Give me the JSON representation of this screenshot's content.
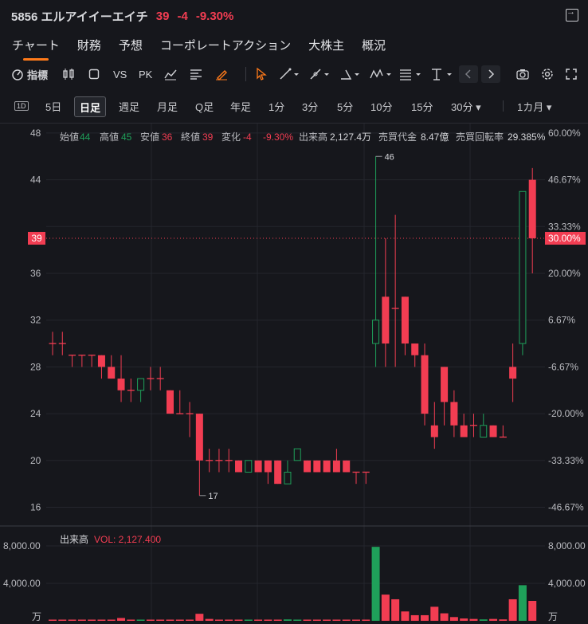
{
  "header": {
    "code_name": "5856 エルアイイーエイチ",
    "price": "39",
    "change": "-4",
    "change_pct": "-9.30%"
  },
  "tabs": [
    "チャート",
    "財務",
    "予想",
    "コーポレートアクション",
    "大株主",
    "概況"
  ],
  "toolbar": {
    "indicator_label": "指標",
    "vs_label": "VS",
    "pk_label": "PK"
  },
  "timeframes": [
    "1D",
    "5日",
    "日足",
    "週足",
    "月足",
    "Q足",
    "年足",
    "1分",
    "3分",
    "5分",
    "10分",
    "15分",
    "30分 ▾",
    "1カ月 ▾"
  ],
  "selected_timeframe": "日足",
  "ohlc_bar": {
    "open_label": "始値",
    "open": "44",
    "high_label": "高値",
    "high": "45",
    "low_label": "安値",
    "low": "36",
    "close_label": "終値",
    "close": "39",
    "chg_label": "変化",
    "chg": "-4",
    "chg_pct": "-9.30%",
    "vol_label": "出来高",
    "vol": "2,127.4万",
    "amount_label": "売買代金",
    "amount": "8.47億",
    "turnover_label": "売買回転率",
    "turnover": "29.385%"
  },
  "volume_legend": {
    "label": "出来高",
    "vol_text": "VOL: 2,127.400"
  },
  "colors": {
    "up": "#1fa05a",
    "down": "#f23d52",
    "bg": "#16171c",
    "grid": "#24262d",
    "text": "#b9babf",
    "accent": "#ff7a1a"
  },
  "chart_data": {
    "type": "candlestick",
    "price_axis": {
      "ticks": [
        16,
        20,
        24,
        28,
        32,
        36,
        40,
        44,
        48
      ],
      "range": [
        15,
        48
      ]
    },
    "percent_axis": {
      "ticks": [
        "60.00%",
        "46.67%",
        "33.33%",
        "20.00%",
        "6.67%",
        "-6.67%",
        "-20.00%",
        "-33.33%",
        "-46.67%"
      ],
      "reference": 30
    },
    "current_price_label": "39",
    "current_pct_label": "30.00%",
    "max_label": "46",
    "min_label": "17",
    "volume_axis": {
      "ticks": [
        "8,000.00",
        "4,000.00"
      ],
      "unit": "万",
      "max": 8000
    },
    "candles": [
      {
        "o": 30,
        "h": 31,
        "l": 29,
        "c": 30,
        "v": 30
      },
      {
        "o": 30,
        "h": 31,
        "l": 29,
        "c": 30,
        "v": 20
      },
      {
        "o": 29,
        "h": 29,
        "l": 28,
        "c": 29,
        "v": 20
      },
      {
        "o": 29,
        "h": 29,
        "l": 28,
        "c": 29,
        "v": 20
      },
      {
        "o": 29,
        "h": 29,
        "l": 28,
        "c": 29,
        "v": 20
      },
      {
        "o": 29,
        "h": 29,
        "l": 27,
        "c": 28,
        "v": 50
      },
      {
        "o": 28,
        "h": 29,
        "l": 27,
        "c": 27,
        "v": 120
      },
      {
        "o": 27,
        "h": 29,
        "l": 25,
        "c": 26,
        "v": 300
      },
      {
        "o": 26,
        "h": 27,
        "l": 25,
        "c": 26,
        "v": 60
      },
      {
        "o": 26,
        "h": 27,
        "l": 25,
        "c": 27,
        "v": 50
      },
      {
        "o": 27,
        "h": 28,
        "l": 26,
        "c": 27,
        "v": 40
      },
      {
        "o": 27,
        "h": 28,
        "l": 26,
        "c": 27,
        "v": 40
      },
      {
        "o": 26,
        "h": 26,
        "l": 24,
        "c": 24,
        "v": 60
      },
      {
        "o": 24,
        "h": 26,
        "l": 24,
        "c": 24,
        "v": 30
      },
      {
        "o": 24,
        "h": 25,
        "l": 22,
        "c": 24,
        "v": 30
      },
      {
        "o": 24,
        "h": 24,
        "l": 17,
        "c": 20,
        "v": 750
      },
      {
        "o": 20,
        "h": 21,
        "l": 19,
        "c": 20,
        "v": 200
      },
      {
        "o": 20,
        "h": 21,
        "l": 19,
        "c": 20,
        "v": 100
      },
      {
        "o": 20,
        "h": 21,
        "l": 19,
        "c": 20,
        "v": 80
      },
      {
        "o": 20,
        "h": 20,
        "l": 19,
        "c": 19,
        "v": 80
      },
      {
        "o": 19,
        "h": 20,
        "l": 19,
        "c": 20,
        "v": 100
      },
      {
        "o": 20,
        "h": 20,
        "l": 19,
        "c": 19,
        "v": 60
      },
      {
        "o": 20,
        "h": 20,
        "l": 18,
        "c": 19,
        "v": 60
      },
      {
        "o": 20,
        "h": 20,
        "l": 18,
        "c": 18,
        "v": 120
      },
      {
        "o": 18,
        "h": 20,
        "l": 18,
        "c": 19,
        "v": 150
      },
      {
        "o": 20,
        "h": 21,
        "l": 20,
        "c": 21,
        "v": 60
      },
      {
        "o": 20,
        "h": 20,
        "l": 19,
        "c": 19,
        "v": 120
      },
      {
        "o": 20,
        "h": 20,
        "l": 19,
        "c": 19,
        "v": 40
      },
      {
        "o": 20,
        "h": 20,
        "l": 19,
        "c": 19,
        "v": 40
      },
      {
        "o": 20,
        "h": 21,
        "l": 19,
        "c": 19,
        "v": 100
      },
      {
        "o": 20,
        "h": 20,
        "l": 19,
        "c": 19,
        "v": 40
      },
      {
        "o": 19,
        "h": 19,
        "l": 18,
        "c": 19,
        "v": 30
      },
      {
        "o": 19,
        "h": 19,
        "l": 18,
        "c": 19,
        "v": 30
      },
      {
        "o": 30,
        "h": 46,
        "l": 28,
        "c": 32,
        "v": 7900
      },
      {
        "o": 34,
        "h": 39,
        "l": 28,
        "c": 30,
        "v": 2800
      },
      {
        "o": 33,
        "h": 41,
        "l": 28,
        "c": 33,
        "v": 2300
      },
      {
        "o": 34,
        "h": 34,
        "l": 29,
        "c": 30,
        "v": 1000
      },
      {
        "o": 30,
        "h": 30,
        "l": 28,
        "c": 29,
        "v": 600
      },
      {
        "o": 29,
        "h": 30,
        "l": 23,
        "c": 24,
        "v": 600
      },
      {
        "o": 23,
        "h": 25,
        "l": 21,
        "c": 22,
        "v": 1500
      },
      {
        "o": 28,
        "h": 28,
        "l": 23,
        "c": 25,
        "v": 800
      },
      {
        "o": 25,
        "h": 26,
        "l": 22,
        "c": 23,
        "v": 400
      },
      {
        "o": 23,
        "h": 24,
        "l": 22,
        "c": 22,
        "v": 250
      },
      {
        "o": 23,
        "h": 24,
        "l": 22,
        "c": 23,
        "v": 200
      },
      {
        "o": 22,
        "h": 24,
        "l": 22,
        "c": 23,
        "v": 150
      },
      {
        "o": 23,
        "h": 23,
        "l": 22,
        "c": 22,
        "v": 200
      },
      {
        "o": 22,
        "h": 23,
        "l": 22,
        "c": 22,
        "v": 150
      },
      {
        "o": 28,
        "h": 30,
        "l": 25,
        "c": 27,
        "v": 2300
      },
      {
        "o": 30,
        "h": 43,
        "l": 29,
        "c": 43,
        "v": 3800
      },
      {
        "o": 44,
        "h": 45,
        "l": 36,
        "c": 39,
        "v": 2127
      }
    ]
  }
}
